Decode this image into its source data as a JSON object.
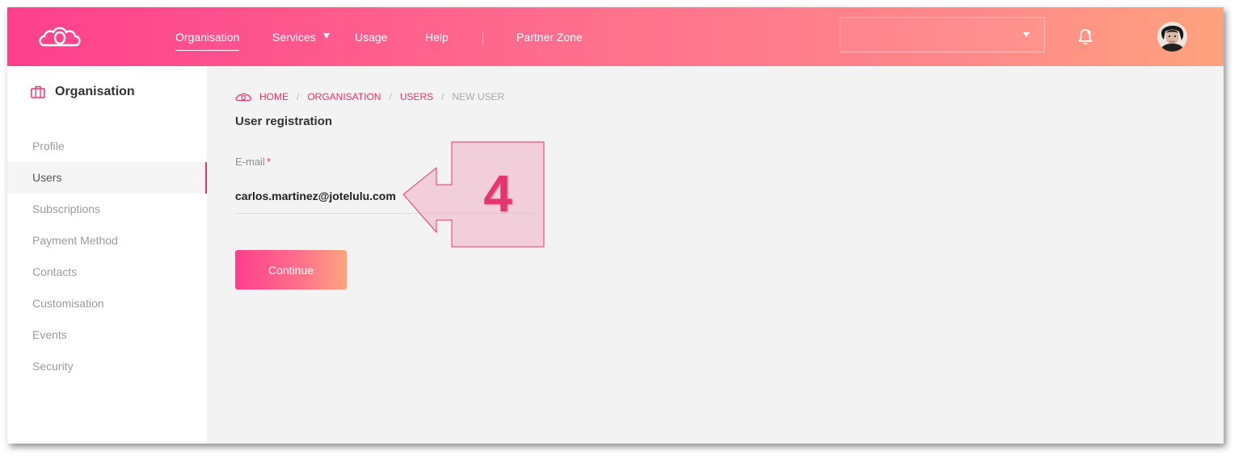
{
  "nav": {
    "items": [
      {
        "label": "Organisation",
        "active": true
      },
      {
        "label": "Services"
      },
      {
        "label": "Usage"
      },
      {
        "label": "Help"
      },
      {
        "label": "Partner Zone"
      }
    ],
    "account_select": {
      "value": ""
    }
  },
  "sidebar": {
    "title": "Organisation",
    "items": [
      {
        "label": "Profile"
      },
      {
        "label": "Users",
        "active": true
      },
      {
        "label": "Subscriptions"
      },
      {
        "label": "Payment Method"
      },
      {
        "label": "Contacts"
      },
      {
        "label": "Customisation"
      },
      {
        "label": "Events"
      },
      {
        "label": "Security"
      }
    ]
  },
  "breadcrumb": {
    "items": [
      "HOME",
      "ORGANISATION",
      "USERS",
      "NEW USER"
    ],
    "separator": "/"
  },
  "form": {
    "title": "User registration",
    "email_label": "E-mail",
    "required_mark": "*",
    "email_value": "carlos.martinez@jotelulu.com",
    "continue_label": "Continue"
  },
  "annotation": {
    "number": "4"
  },
  "colors": {
    "accent": "#e5356f",
    "header_start": "#fe3f8d",
    "header_end": "#ffa27e"
  },
  "icons": {
    "logo": "cloud-logo-icon",
    "services_caret": "caret-down-icon",
    "notifications": "bell-icon",
    "sidebar_header": "briefcase-icon",
    "breadcrumb_home": "cloud-icon"
  }
}
